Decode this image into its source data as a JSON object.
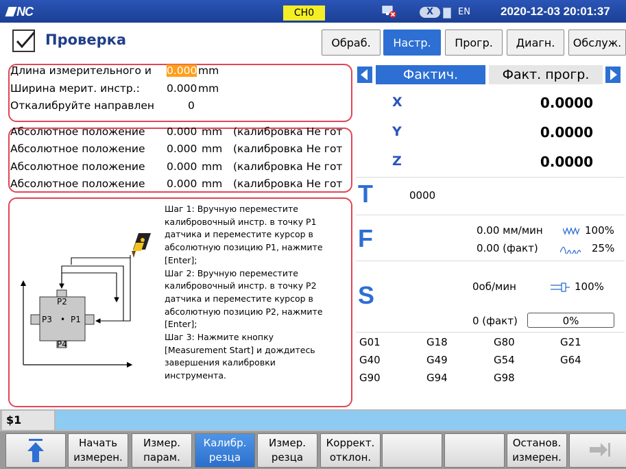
{
  "topbar": {
    "logo": "NC",
    "channel": "CH0",
    "x_badge": "X",
    "lang": "EN",
    "datetime": "2020-12-03 20:01:37"
  },
  "header": {
    "title": "Проверка",
    "tabs": [
      {
        "label": "Обраб.",
        "active": false
      },
      {
        "label": "Настр.",
        "active": true
      },
      {
        "label": "Прогр.",
        "active": false
      },
      {
        "label": "Диагн.",
        "active": false
      },
      {
        "label": "Обслуж.",
        "active": false
      }
    ]
  },
  "params": [
    {
      "label": "Длина измерительного и",
      "value": "0.000",
      "unit": "mm"
    },
    {
      "label": "Ширина мерит. инстр.:",
      "value": "0.000",
      "unit": "mm"
    },
    {
      "label": "Откалибруйте направлен",
      "value": "0",
      "unit": ""
    }
  ],
  "positions": [
    {
      "label": "Абсолютное положение",
      "value": "0.000",
      "unit": "mm",
      "status": "(калибровка Не гот"
    },
    {
      "label": "Абсолютное положение",
      "value": "0.000",
      "unit": "mm",
      "status": "(калибровка Не гот"
    },
    {
      "label": "Абсолютное положение",
      "value": "0.000",
      "unit": "mm",
      "status": "(калибровка Не гот"
    },
    {
      "label": "Абсолютное положение",
      "value": "0.000",
      "unit": "mm",
      "status": "(калибровка Не гот"
    }
  ],
  "diagram": {
    "p1": "P1",
    "p2": "P2",
    "p3": "P3",
    "p4": "P4",
    "dot": "•"
  },
  "steps": [
    "Шаг 1: Вручную переместите",
    "калибровочный инстр. в точку P1",
    "датчика и переместите курсор в",
    "абсолютную позицию P1, нажмите",
    "[Enter];",
    "Шаг 2: Вручную переместите",
    "калибровочный инстр. в точку P2",
    "датчика и переместите курсор в",
    "абсолютную позицию P2, нажмите",
    "[Enter];",
    "Шаг 3: Нажмите кнопку",
    "[Measurement Start] и дождитесь",
    "завершения калибровки",
    "инструмента."
  ],
  "coords": {
    "tab_actual": "Фактич.",
    "tab_prog": "Факт. прогр.",
    "axes": [
      {
        "name": "X",
        "value": "0.0000"
      },
      {
        "name": "Y",
        "value": "0.0000"
      },
      {
        "name": "Z",
        "value": "0.0000"
      }
    ]
  },
  "tool": {
    "letter": "T",
    "value": "0000"
  },
  "feed": {
    "letter": "F",
    "rate": "0.00 мм/мин",
    "override": "100%",
    "actual": "0.00 (факт)",
    "rapid": "25%"
  },
  "spindle": {
    "letter": "S",
    "speed": "0об/мин",
    "override": "100%",
    "actual": "0 (факт)",
    "load": "0%"
  },
  "gcodes": [
    [
      "G01",
      "G18",
      "G80",
      "G21"
    ],
    [
      "G40",
      "G49",
      "G54",
      "G64"
    ],
    [
      "G90",
      "G94",
      "G98",
      ""
    ]
  ],
  "cmd": {
    "label": "$1"
  },
  "softkeys": [
    {
      "l1": "",
      "l2": "",
      "active": false
    },
    {
      "l1": "Начать",
      "l2": "измерен.",
      "active": false
    },
    {
      "l1": "Измер.",
      "l2": "парам.",
      "active": false
    },
    {
      "l1": "Калибр.",
      "l2": "резца",
      "active": true
    },
    {
      "l1": "Измер.",
      "l2": "резца",
      "active": false
    },
    {
      "l1": "Коррект.",
      "l2": "отклон.",
      "active": false
    },
    {
      "l1": "",
      "l2": "",
      "active": false
    },
    {
      "l1": "",
      "l2": "",
      "active": false
    },
    {
      "l1": "Останов.",
      "l2": "измерен.",
      "active": false
    },
    {
      "l1": "",
      "l2": "",
      "active": false
    }
  ],
  "colors": {
    "accent": "#2d6fd3",
    "highlight": "#ff9e1b",
    "panel_border": "#e04555",
    "channel": "#f4ee28"
  }
}
